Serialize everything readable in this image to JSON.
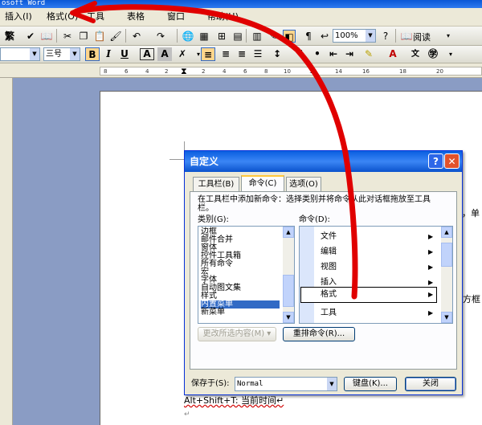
{
  "window": {
    "title": "osoft Word"
  },
  "menubar": {
    "items": [
      "插入(I)",
      "格式(O)",
      "工具",
      "表格",
      "窗口",
      "帮助(H)"
    ]
  },
  "toolbar": {
    "trad_label": "繁",
    "zoom": "100%",
    "read_label": "阅读"
  },
  "format_toolbar": {
    "font_size": "三号",
    "bold": "B",
    "italic": "I",
    "underline": "U",
    "charborder": "A",
    "shading": "A"
  },
  "ruler": {
    "numbers": [
      "8",
      "6",
      "4",
      "2",
      "2",
      "4",
      "6",
      "8",
      "10",
      "12",
      "14",
      "16",
      "18",
      "20"
    ]
  },
  "document": {
    "lines": [
      "Alt+Shift+T: 当前时间↵",
      "↵"
    ],
    "right_fragments": [
      "\"，单",
      "方框"
    ]
  },
  "dialog": {
    "title": "自定义",
    "tabs": [
      "工具栏(B)",
      "命令(C)",
      "选项(O)"
    ],
    "instruction_line1": "在工具栏中添加新命令：选择类别并将命令从此对话框拖放至工具",
    "instruction_line2": "栏。",
    "category_label": "类别(G):",
    "commands_label": "命令(D):",
    "categories": [
      "边框",
      "邮件合并",
      "窗体",
      "控件工具箱",
      "所有命令",
      "宏",
      "字体",
      "自动图文集",
      "样式",
      "内置菜单",
      "新菜单"
    ],
    "selected_category": "内置菜单",
    "commands": [
      "文件",
      "编辑",
      "视图",
      "插入",
      "格式",
      "工具"
    ],
    "selected_command": "格式",
    "modify_button": "更改所选内容(M) ▾",
    "rearrange_button": "重排命令(R)...",
    "save_in_label": "保存于(S):",
    "save_in_value": "Normal",
    "keyboard_button": "键盘(K)...",
    "close_button": "关闭"
  },
  "colors": {
    "titlebar": "#0a58d6",
    "selection": "#316ac5",
    "annotation": "#e00000"
  }
}
